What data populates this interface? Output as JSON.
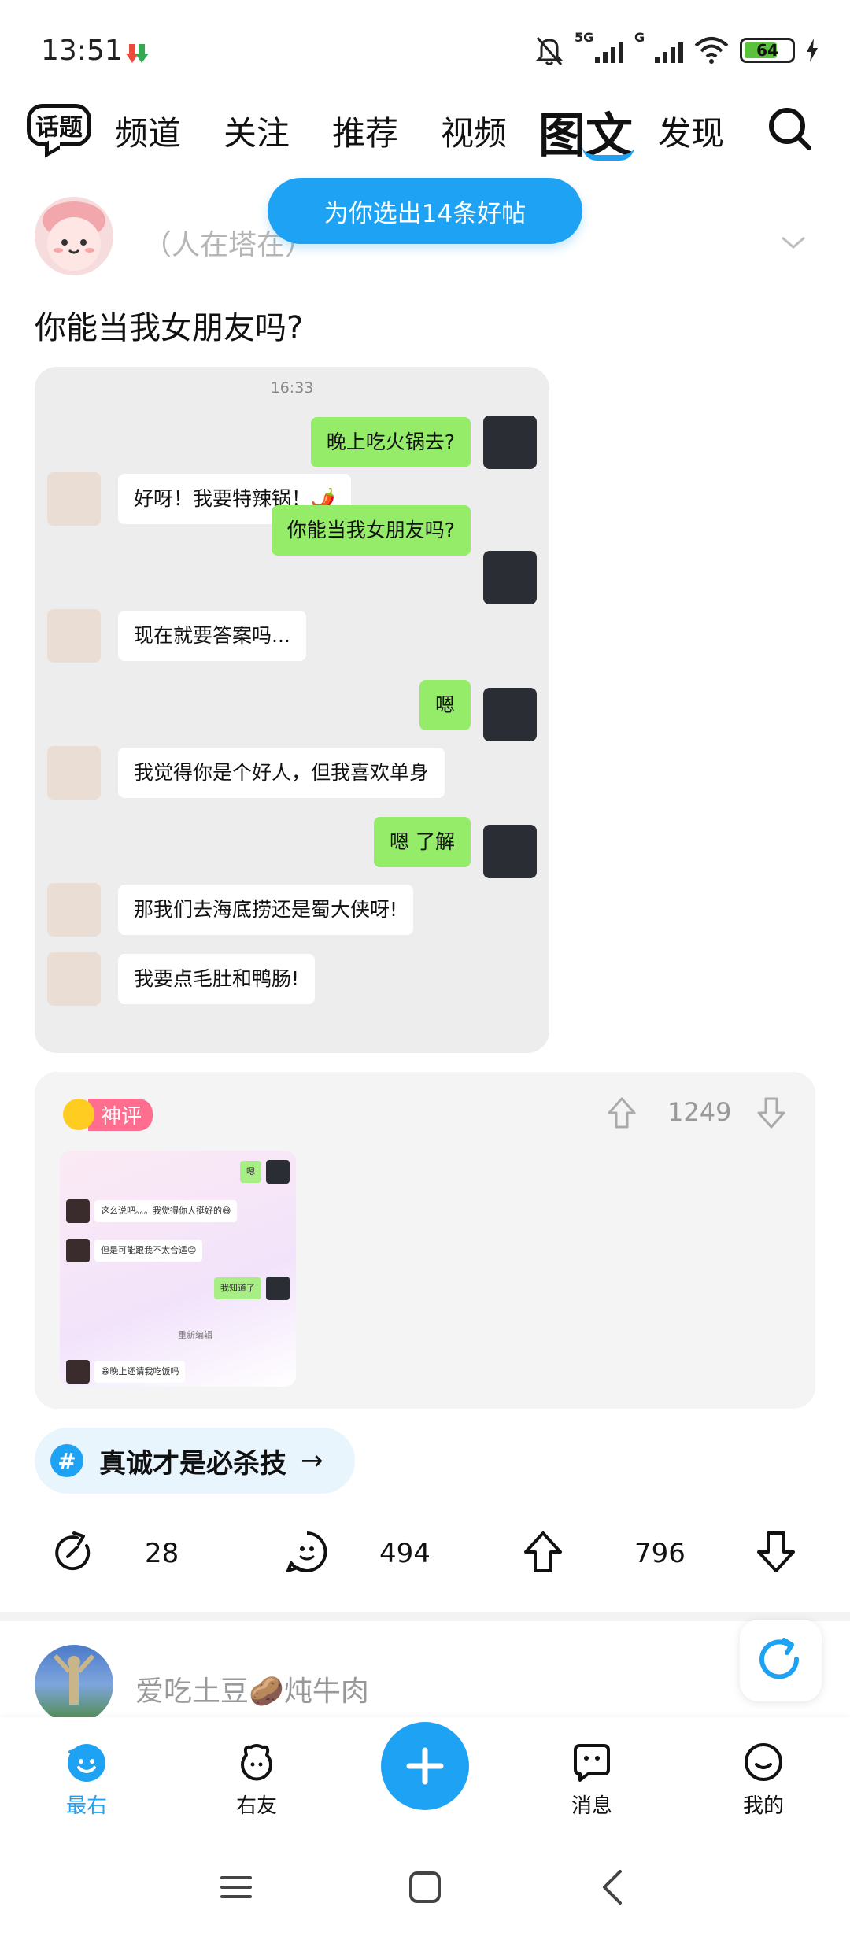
{
  "status_bar": {
    "time": "13:51",
    "signal1_label": "5G",
    "signal2_label": "G",
    "battery": "64"
  },
  "nav": {
    "topic_badge": "话题",
    "tabs": [
      "频道",
      "关注",
      "推荐",
      "视频",
      "图文",
      "发现"
    ],
    "active_tab": "图文"
  },
  "toast": "为你选出14条好帖",
  "post": {
    "author": "（人在塔在）",
    "title": "你能当我女朋友吗?",
    "chat": {
      "time": "16:33",
      "messages": [
        {
          "side": "right",
          "text": "晚上吃火锅去?"
        },
        {
          "side": "left",
          "text": "好呀！我要特辣锅！🌶️"
        },
        {
          "side": "right",
          "text": "你能当我女朋友吗?"
        },
        {
          "side": "left",
          "text": "现在就要答案吗..."
        },
        {
          "side": "right",
          "text": "嗯"
        },
        {
          "side": "left",
          "text": "我觉得你是个好人，但我喜欢单身"
        },
        {
          "side": "right",
          "text": "嗯 了解"
        },
        {
          "side": "left",
          "text": "那我们去海底捞还是蜀大侠呀!"
        },
        {
          "side": "left",
          "text": "我要点毛肚和鸭肠!"
        }
      ]
    },
    "god_comment": {
      "badge": "神评",
      "upvotes": "1249",
      "image_messages": [
        {
          "side": "right",
          "text": "嗯"
        },
        {
          "side": "left",
          "text": "这么说吧。。。我觉得你人挺好的😅"
        },
        {
          "side": "left",
          "text": "但是可能跟我不太合适😊"
        },
        {
          "side": "right",
          "text": "我知道了"
        },
        {
          "side": "center",
          "text": "重新编辑"
        },
        {
          "side": "left",
          "text": "😀晚上还请我吃饭吗"
        }
      ]
    },
    "topic": "真诚才是必杀技",
    "topic_arrow": "→",
    "actions": {
      "shares": "28",
      "comments": "494",
      "likes": "796"
    }
  },
  "next_post": {
    "author": "爱吃土豆🥔炖牛肉"
  },
  "bottom_nav": {
    "items": [
      "最右",
      "右友",
      "消息",
      "我的"
    ],
    "active": "最右"
  },
  "colors": {
    "accent": "#1ea2f4",
    "chat_green": "#95ec69",
    "badge_pink": "#ff6e8f"
  }
}
